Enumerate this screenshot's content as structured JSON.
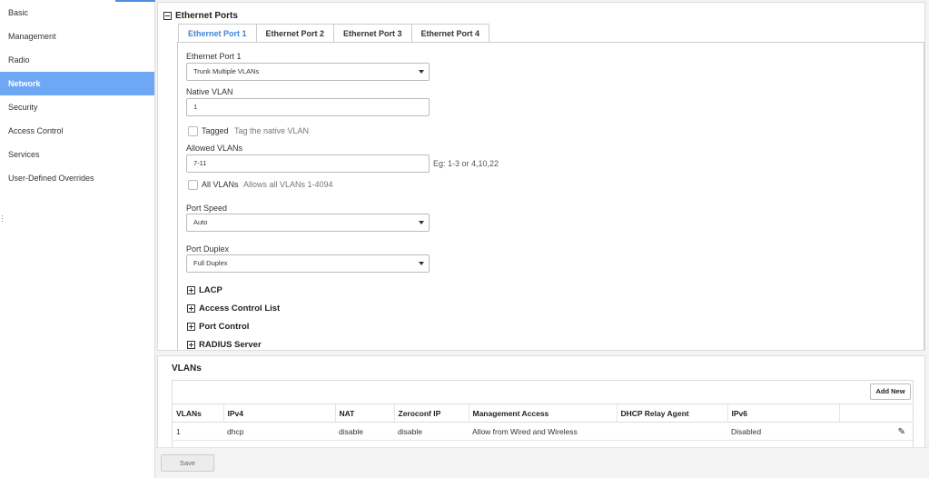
{
  "sidebar": {
    "items": [
      {
        "label": "Basic"
      },
      {
        "label": "Management"
      },
      {
        "label": "Radio"
      },
      {
        "label": "Network"
      },
      {
        "label": "Security"
      },
      {
        "label": "Access Control"
      },
      {
        "label": "Services"
      },
      {
        "label": "User-Defined Overrides"
      }
    ],
    "active": "Network"
  },
  "ethernet": {
    "title": "Ethernet Ports",
    "tabs": [
      "Ethernet Port 1",
      "Ethernet Port 2",
      "Ethernet Port 3",
      "Ethernet Port 4"
    ],
    "active_tab": "Ethernet Port 1",
    "port_label": "Ethernet Port 1",
    "port_mode": "Trunk Multiple VLANs",
    "native_vlan_label": "Native VLAN",
    "native_vlan_value": "1",
    "tagged_label": "Tagged",
    "tagged_hint": "Tag the native VLAN",
    "allowed_vlans_label": "Allowed VLANs",
    "allowed_vlans_value": "7-11",
    "allowed_vlans_hint": "Eg: 1-3 or 4,10,22",
    "all_vlans_label": "All VLANs",
    "all_vlans_hint": "Allows all VLANs 1-4094",
    "port_speed_label": "Port Speed",
    "port_speed_value": "Auto",
    "port_duplex_label": "Port Duplex",
    "port_duplex_value": "Full Duplex",
    "sections": [
      "LACP",
      "Access Control List",
      "Port Control",
      "RADIUS Server"
    ]
  },
  "vlans": {
    "title": "VLANs",
    "add_label": "Add New",
    "columns": [
      "VLANs",
      "IPv4",
      "NAT",
      "Zeroconf IP",
      "Management Access",
      "DHCP Relay Agent",
      "IPv6",
      ""
    ],
    "rows": [
      [
        "1",
        "dhcp",
        "disable",
        "disable",
        "Allow from Wired and Wireless",
        "",
        "Disabled",
        ""
      ]
    ]
  },
  "footer": {
    "save_label": "Save"
  },
  "colors": {
    "accent": "#6ea8f4",
    "tab_active": "#3a87d6"
  }
}
